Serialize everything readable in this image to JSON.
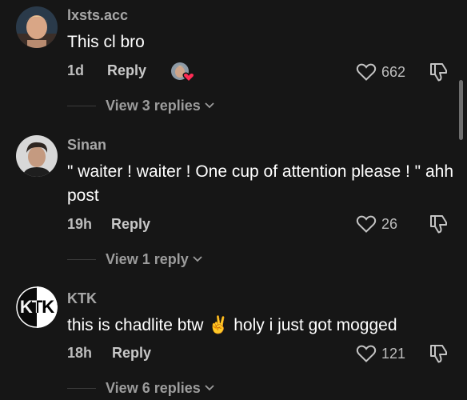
{
  "colors": {
    "background": "#161616",
    "username": "#a7a7a7",
    "meta": "#bdbdbd",
    "like_heart": "#ff2c55"
  },
  "comments": [
    {
      "username": "lxsts.acc",
      "text": "This cl bro",
      "time": "1d",
      "reply_label": "Reply",
      "likes": "662",
      "liked_by_creator": true,
      "view_replies": "View 3 replies",
      "icons": {
        "like": "heart-outline-icon",
        "dislike": "dislike-icon",
        "expand": "chevron-down-icon"
      }
    },
    {
      "username": "Sinan",
      "text": "\" waiter ! waiter ! One cup of attention please ! \" ahh post",
      "time": "19h",
      "reply_label": "Reply",
      "likes": "26",
      "view_replies": "View 1 reply",
      "icons": {
        "like": "heart-outline-icon",
        "dislike": "dislike-icon",
        "expand": "chevron-down-icon"
      }
    },
    {
      "username": "KTK",
      "avatar_text": "KTK",
      "text": "this is chadlite btw ✌️ holy i just got mogged",
      "time": "18h",
      "reply_label": "Reply",
      "likes": "121",
      "view_replies": "View 6 replies",
      "icons": {
        "like": "heart-outline-icon",
        "dislike": "dislike-icon",
        "expand": "chevron-down-icon"
      }
    }
  ]
}
